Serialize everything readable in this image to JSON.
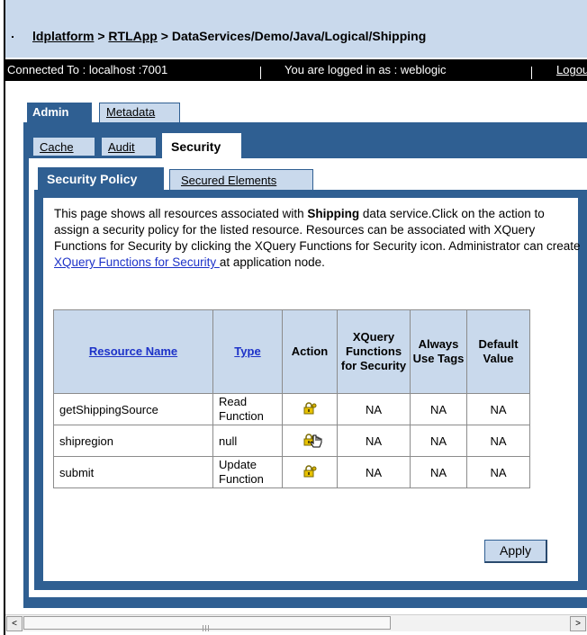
{
  "breadcrumb": {
    "root": "ldplatform",
    "sep1": " > ",
    "app": "RTLApp",
    "sep2": " > ",
    "path": "DataServices/Demo/Java/Logical/Shipping"
  },
  "status": {
    "connected": "Connected To :  localhost :7001",
    "logged_in": "You are logged in as :  weblogic",
    "logout": "Logout"
  },
  "tabs_top": {
    "admin": "Admin",
    "metadata": "Metadata"
  },
  "tabs_admin": {
    "cache": "Cache",
    "audit": "Audit",
    "security": "Security"
  },
  "tabs_security": {
    "policy": "Security Policy",
    "secured": "Secured Elements"
  },
  "description": {
    "part1": "This page shows all resources associated with ",
    "bold": "Shipping",
    "part2": " data service.Click on the action to assign a security policy for the listed resource. Resources can be associated with XQuery Functions for Security by clicking the XQuery Functions for Security icon. Administrator can create ",
    "link": "XQuery Functions for Security ",
    "part3": "at application node."
  },
  "table": {
    "headers": {
      "resource_name": "Resource Name",
      "type": "Type",
      "action": "Action",
      "xquery": "XQuery Functions for Security",
      "always_use_tags": "Always Use Tags",
      "default_value": "Default Value"
    },
    "rows": [
      {
        "name": "getShippingSource",
        "type": "Read Function",
        "xquery": "NA",
        "always": "NA",
        "default": "NA"
      },
      {
        "name": "shipregion",
        "type": "null",
        "xquery": "NA",
        "always": "NA",
        "default": "NA"
      },
      {
        "name": "submit",
        "type": "Update Function",
        "xquery": "NA",
        "always": "NA",
        "default": "NA"
      }
    ]
  },
  "apply_label": "Apply",
  "scrollbar": {
    "left": "<",
    "right": ">"
  },
  "colors": {
    "header_bg": "#c9d9ec",
    "panel_blue": "#2f5f92",
    "link": "#1d32c8"
  },
  "icons": {
    "action": "lock-key-icon",
    "pointer": "hand-cursor-icon"
  }
}
